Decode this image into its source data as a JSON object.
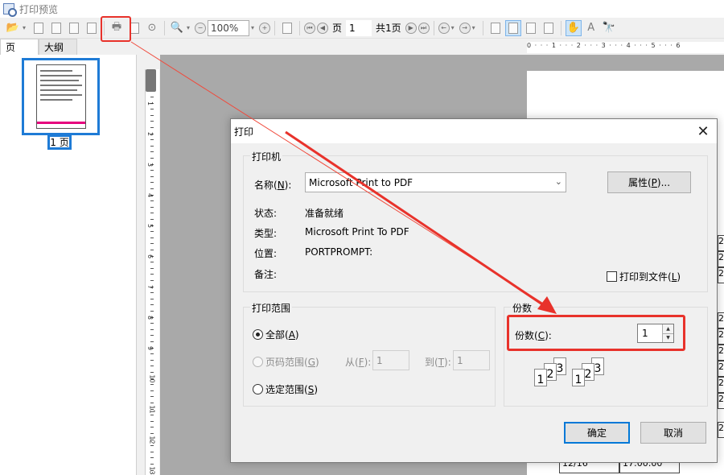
{
  "window": {
    "title": "打印预览"
  },
  "toolbar": {
    "zoom": "100%",
    "page_label": "页",
    "page_value": "1",
    "total_pages": "共1页"
  },
  "left_panel": {
    "tabs": [
      {
        "label": "页"
      },
      {
        "label": "大纲"
      }
    ],
    "thumbnail_label": "1 页"
  },
  "ruler": {
    "h_marks": "0 · · · 1 · · · 2 · · · 3 · · · 4 · · · 5 · · · 6",
    "v_marks": [
      "1",
      "2",
      "3",
      "4",
      "5",
      "6",
      "7",
      "8",
      "9",
      "10",
      "11",
      "12",
      "13"
    ]
  },
  "paper": {
    "cells": [
      "2",
      "2",
      "2",
      "2",
      "2",
      "2",
      "2",
      "2",
      "2",
      "2"
    ],
    "bottom_left": "12/16",
    "bottom_right": "17:00:00"
  },
  "dialog": {
    "title": "打印",
    "printer_group": {
      "title": "打印机",
      "name_label": "名称(",
      "name_key": "N",
      "name_suffix": "):",
      "name_value": "Microsoft Print to PDF",
      "properties_label": "属性(",
      "properties_key": "P",
      "properties_suffix": ")...",
      "status_label": "状态:",
      "status_value": "准备就绪",
      "type_label": "类型:",
      "type_value": "Microsoft Print To PDF",
      "location_label": "位置:",
      "location_value": "PORTPROMPT:",
      "comment_label": "备注:",
      "print_to_file_label": "打印到文件(",
      "print_to_file_key": "L",
      "print_to_file_suffix": ")"
    },
    "range_group": {
      "title": "打印范围",
      "all_label": "全部(",
      "all_key": "A",
      "all_suffix": ")",
      "pages_label": "页码范围(",
      "pages_key": "G",
      "pages_suffix": ")",
      "from_label": "从(",
      "from_key": "F",
      "from_suffix": "):",
      "from_value": "1",
      "to_label": "到(",
      "to_key": "T",
      "to_suffix": "):",
      "to_value": "1",
      "selection_label": "选定范围(",
      "selection_key": "S",
      "selection_suffix": ")"
    },
    "copies_group": {
      "title": "份数",
      "copies_label": "份数(",
      "copies_key": "C",
      "copies_suffix": "):",
      "copies_value": "1",
      "collate_sheets": [
        "1",
        "2",
        "3"
      ]
    },
    "ok_label": "确定",
    "cancel_label": "取消"
  },
  "colors": {
    "highlight": "#e8322b",
    "selection_blue": "#1e7bd6",
    "dialog_primary": "#0078d7"
  }
}
